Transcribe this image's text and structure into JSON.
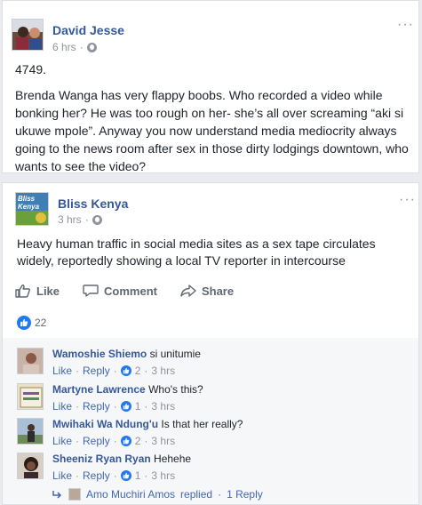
{
  "post1": {
    "author": "David Jesse",
    "time": "6 hrs",
    "number": "4749.",
    "body": "Brenda Wanga has very flappy boobs. Who recorded a video while bonking her? He was too rough on her- she’s all over screaming “aki si ukuwe mpole”. Anyway you now understand media mediocrity always going to the news room after sex in those dirty lodgings downtown, who wants to see the video?",
    "more": "···"
  },
  "post2": {
    "author": "Bliss Kenya",
    "avatar_text": "Bliss Kenya",
    "time": "3 hrs",
    "body": "Heavy human traffic in social media sites as a sex tape circulates widely, reportedly showing a local TV reporter in intercourse",
    "more": "···",
    "actions": {
      "like": "Like",
      "comment": "Comment",
      "share": "Share"
    },
    "like_count": "22",
    "comments": [
      {
        "name": "Wamoshie Shiemo",
        "text": "si unitumie",
        "like": "Like",
        "reply": "Reply",
        "reactions": "2",
        "time": "3 hrs"
      },
      {
        "name": "Martyne Lawrence",
        "text": "Who's this?",
        "like": "Like",
        "reply": "Reply",
        "reactions": "1",
        "time": "3 hrs"
      },
      {
        "name": "Mwihaki Wa Ndung'u",
        "text": "Is that her really?",
        "like": "Like",
        "reply": "Reply",
        "reactions": "2",
        "time": "3 hrs"
      },
      {
        "name": "Sheeniz Ryan Ryan",
        "text": "Hehehe",
        "like": "Like",
        "reply": "Reply",
        "reactions": "1",
        "time": "3 hrs"
      }
    ],
    "reply_summary": {
      "name": "Amo Muchiri Amos",
      "verb": "replied",
      "count": "1 Reply"
    }
  },
  "colors": {
    "link": "#365899",
    "like_blue": "#2078f4",
    "meta_gray": "#90949c"
  },
  "icons": {
    "privacy": "globe-icon",
    "like": "thumbs-up-icon",
    "comment": "speech-bubble-icon",
    "share": "share-arrow-icon"
  }
}
